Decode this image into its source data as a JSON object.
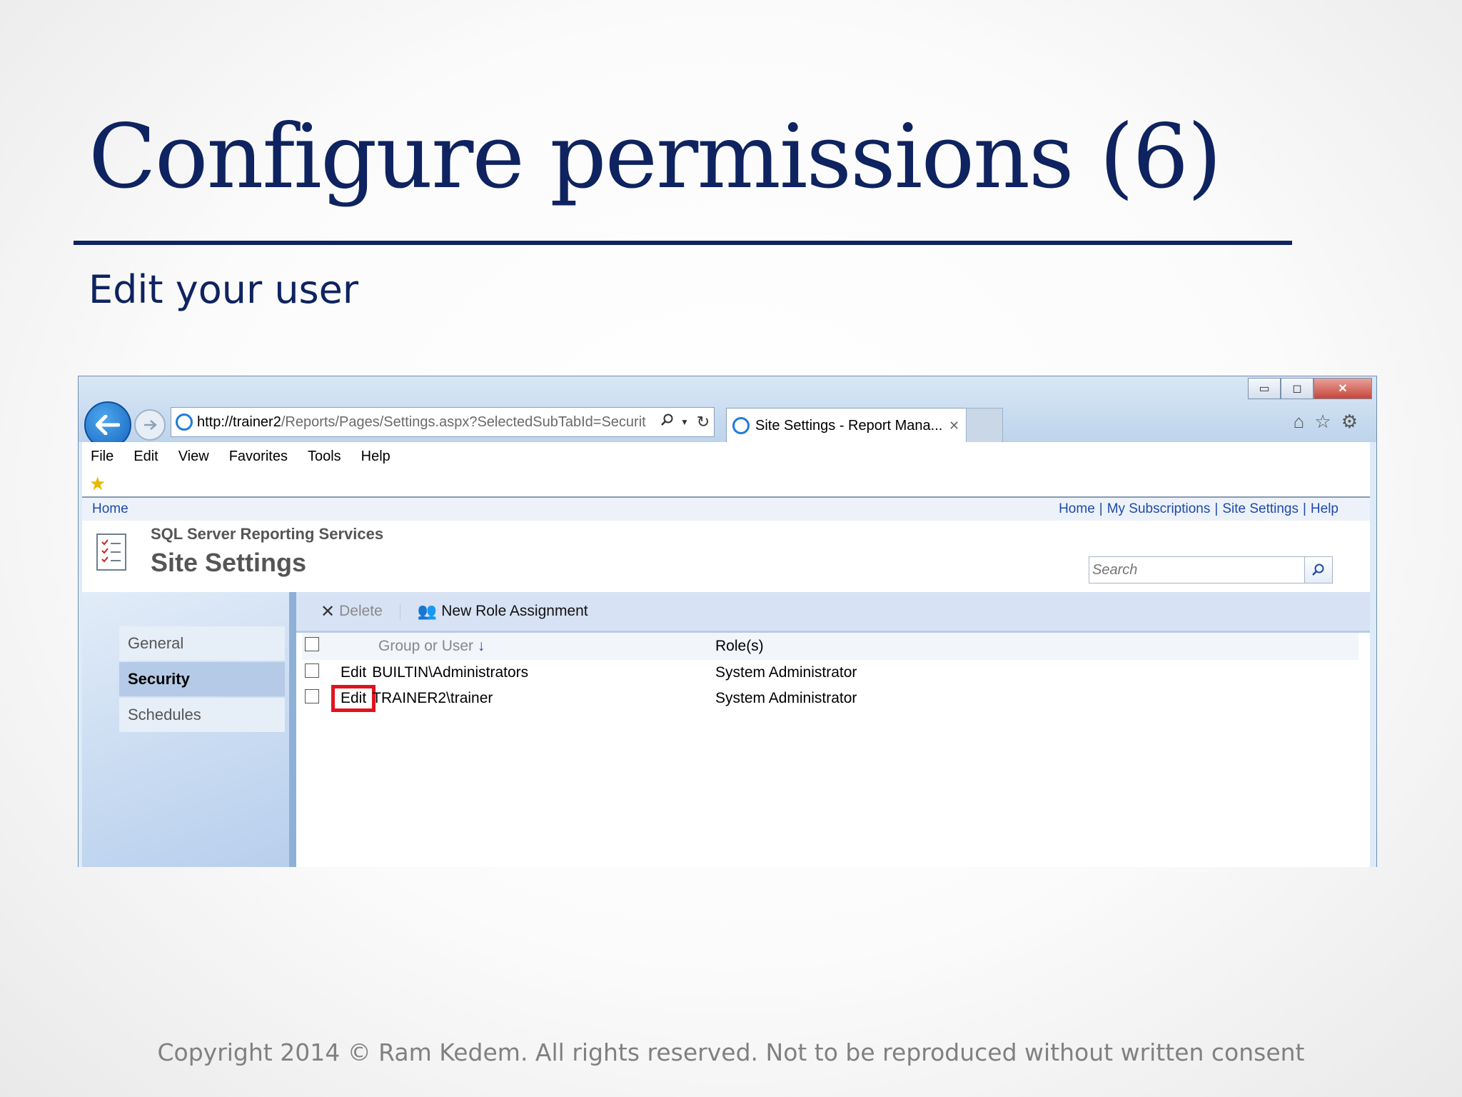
{
  "slide": {
    "title": "Configure permissions (6)",
    "subtitle": "Edit your user",
    "footer": "Copyright 2014 © Ram Kedem. All rights reserved. Not to be reproduced without written consent"
  },
  "browser": {
    "window_buttons": {
      "minimize": "▭",
      "maximize": "◻",
      "close": "✕"
    },
    "address_host": "http://trainer2",
    "address_path": "/Reports/Pages/Settings.aspx?SelectedSubTabId=Securit",
    "tab_title": "Site Settings - Report Mana...",
    "menu": [
      "File",
      "Edit",
      "View",
      "Favorites",
      "Tools",
      "Help"
    ],
    "icons": [
      "back-arrow-icon",
      "forward-arrow-icon",
      "ie-icon",
      "search-icon",
      "dropdown-icon",
      "refresh-icon",
      "home-icon",
      "star-icon",
      "gear-icon"
    ]
  },
  "ssrs": {
    "breadcrumb": "Home",
    "top_links": [
      "Home",
      "My Subscriptions",
      "Site Settings",
      "Help"
    ],
    "product": "SQL Server Reporting Services",
    "page_title": "Site Settings",
    "search_placeholder": "Search",
    "nav": [
      "General",
      "Security",
      "Schedules"
    ],
    "active_nav": "Security",
    "actions": {
      "delete": "Delete",
      "new_role": "New Role Assignment"
    },
    "table": {
      "headers": {
        "group": "Group or User",
        "roles": "Role(s)"
      },
      "rows": [
        {
          "edit": "Edit",
          "user": "BUILTIN\\Administrators",
          "roles": "System Administrator",
          "highlighted": false
        },
        {
          "edit": "Edit",
          "user": "TRAINER2\\trainer",
          "roles": "System Administrator",
          "highlighted": true
        }
      ]
    }
  },
  "colors": {
    "title": "#0e2360",
    "highlight": "#e0141e",
    "link": "#1e4aa8"
  }
}
